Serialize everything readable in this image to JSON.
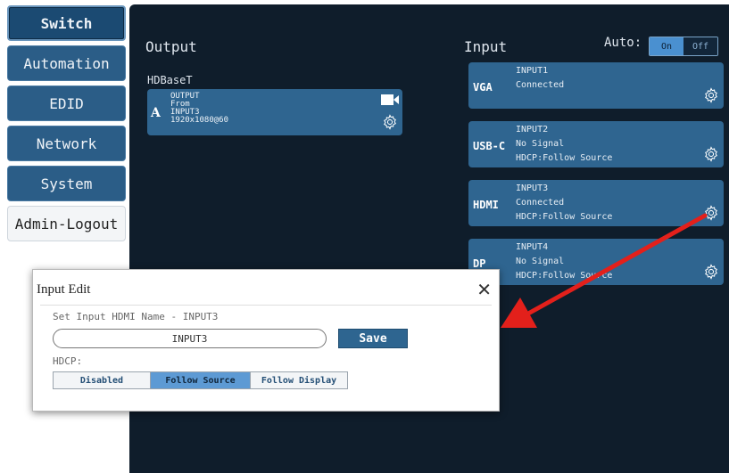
{
  "sidebar": {
    "items": [
      {
        "label": "Switch",
        "active": true
      },
      {
        "label": "Automation"
      },
      {
        "label": "EDID"
      },
      {
        "label": "Network"
      },
      {
        "label": "System"
      },
      {
        "label": "Admin-Logout"
      }
    ]
  },
  "output": {
    "title": "Output",
    "group": "HDBaseT",
    "card": {
      "letter": "A",
      "name": "OUTPUT",
      "from_label": "From",
      "source": "INPUT3",
      "resolution": "1920x1080@60"
    }
  },
  "input": {
    "title": "Input",
    "auto_label": "Auto:",
    "auto_on": "On",
    "auto_off": "Off",
    "cards": [
      {
        "type": "VGA",
        "name": "INPUT1",
        "status": "Connected",
        "hdcp": ""
      },
      {
        "type": "USB-C",
        "name": "INPUT2",
        "status": "No Signal",
        "hdcp": "HDCP:Follow Source"
      },
      {
        "type": "HDMI",
        "name": "INPUT3",
        "status": "Connected",
        "hdcp": "HDCP:Follow Source"
      },
      {
        "type": "DP",
        "name": "INPUT4",
        "status": "No Signal",
        "hdcp": "HDCP:Follow Source"
      }
    ]
  },
  "dialog": {
    "title": "Input Edit",
    "close": "✕",
    "subtitle": "Set Input HDMI Name - INPUT3",
    "name_value": "INPUT3",
    "save_label": "Save",
    "hdcp_label": "HDCP:",
    "hdcp_options": [
      "Disabled",
      "Follow Source",
      "Follow Display"
    ],
    "hdcp_selected": "Follow Source"
  },
  "colors": {
    "panel_bg": "#0f1d2b",
    "card_bg": "#2f6590",
    "accent": "#4a90d0",
    "arrow": "#e3201b"
  }
}
